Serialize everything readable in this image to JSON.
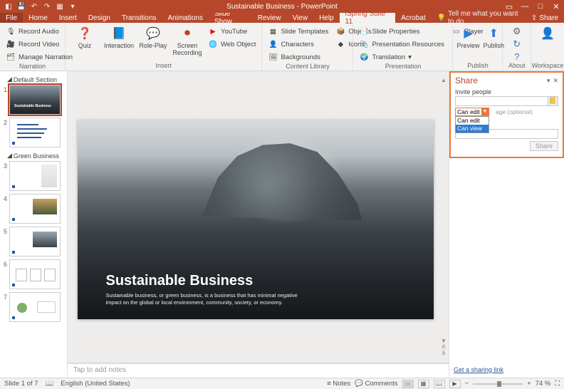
{
  "app": {
    "title": "Sustainable Business - PowerPoint"
  },
  "tabs": {
    "file": "File",
    "home": "Home",
    "insert": "Insert",
    "design": "Design",
    "transitions": "Transitions",
    "animations": "Animations",
    "slideshow": "Slide Show",
    "review": "Review",
    "view": "View",
    "help": "Help",
    "ispring": "iSpring Suite 11",
    "acrobat": "Acrobat",
    "tell": "Tell me what you want to do",
    "share": "Share"
  },
  "ribbon": {
    "narration": {
      "label": "Narration",
      "record_audio": "Record Audio",
      "record_video": "Record Video",
      "manage": "Manage Narration"
    },
    "insert": {
      "label": "Insert",
      "quiz": "Quiz",
      "interaction": "Interaction",
      "roleplay": "Role-Play",
      "screen": "Screen Recording",
      "youtube": "YouTube",
      "webobject": "Web Object"
    },
    "content": {
      "label": "Content Library",
      "templates": "Slide Templates",
      "characters": "Characters",
      "backgrounds": "Backgrounds",
      "objects": "Objects",
      "icons": "Icons"
    },
    "presentation": {
      "label": "Presentation",
      "properties": "Slide Properties",
      "resources": "Presentation Resources",
      "translation": "Translation",
      "player": "Player"
    },
    "publish": {
      "label": "Publish",
      "preview": "Preview",
      "publish": "Publish"
    },
    "about": {
      "label": "About"
    },
    "workspace": {
      "label": "Workspace"
    }
  },
  "sections": {
    "default": "Default Section",
    "green": "Green Business"
  },
  "slide": {
    "title": "Sustainable Business",
    "subtitle": "Sustainable business, or green business, is a business that has minimal negative impact on the global or local environment, community, society, or economy."
  },
  "notes_placeholder": "Tap to add notes",
  "share_pane": {
    "title": "Share",
    "invite": "Invite people",
    "perm_selected": "Can edit",
    "perm_opt1": "Can edit",
    "perm_opt2": "Can view",
    "msg_hint": "age (optional)",
    "send": "Share",
    "link": "Get a sharing link"
  },
  "status": {
    "slide": "Slide 1 of 7",
    "lang": "English (United States)",
    "notes": "Notes",
    "comments": "Comments",
    "zoom": "74 %"
  }
}
